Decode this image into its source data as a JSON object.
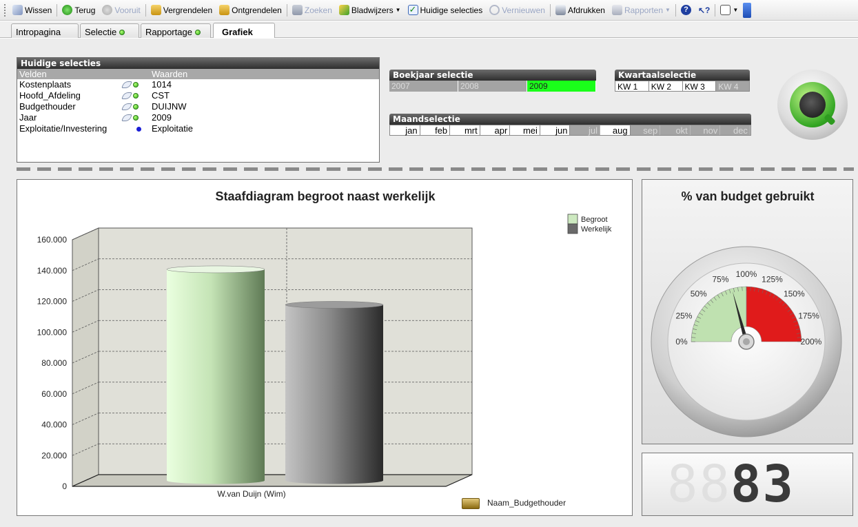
{
  "toolbar": {
    "items": [
      {
        "label": "Wissen",
        "enabled": true
      },
      {
        "label": "Terug",
        "enabled": true
      },
      {
        "label": "Vooruit",
        "enabled": false
      },
      {
        "label": "Vergrendelen",
        "enabled": true
      },
      {
        "label": "Ontgrendelen",
        "enabled": true
      },
      {
        "label": "Zoeken",
        "enabled": false
      },
      {
        "label": "Bladwijzers",
        "enabled": true
      },
      {
        "label": "Huidige selecties",
        "enabled": true
      },
      {
        "label": "Vernieuwen",
        "enabled": false
      },
      {
        "label": "Afdrukken",
        "enabled": true
      },
      {
        "label": "Rapporten",
        "enabled": false
      }
    ]
  },
  "tabs": [
    {
      "label": "Intropagina",
      "indicator": false
    },
    {
      "label": "Selectie",
      "indicator": true
    },
    {
      "label": "Rapportage",
      "indicator": true
    },
    {
      "label": "Grafiek",
      "indicator": false,
      "active": true
    }
  ],
  "current_selections": {
    "title": "Huidige selecties",
    "col_fields": "Velden",
    "col_values": "Waarden",
    "rows": [
      {
        "field": "Kostenplaats",
        "value": "1014"
      },
      {
        "field": "Hoofd_Afdeling",
        "value": "CST"
      },
      {
        "field": "Budgethouder",
        "value": "DUIJNW"
      },
      {
        "field": "Jaar",
        "value": "2009"
      },
      {
        "field": "Exploitatie/Investering",
        "value": "Exploitatie"
      }
    ]
  },
  "fiscal_year": {
    "title": "Boekjaar selectie",
    "values": [
      "2007",
      "2008",
      "2009"
    ],
    "selected": "2009"
  },
  "quarter": {
    "title": "Kwartaalselectie",
    "values": [
      "KW 1",
      "KW 2",
      "KW 3",
      "KW 4"
    ]
  },
  "month": {
    "title": "Maandselectie",
    "values": [
      "jan",
      "feb",
      "mrt",
      "apr",
      "mei",
      "jun",
      "jul",
      "aug",
      "sep",
      "okt",
      "nov",
      "dec"
    ]
  },
  "bar_chart": {
    "title": "Staafdiagram begroot naast werkelijk",
    "dimension_label": "Naam_Budgethouder"
  },
  "gauge": {
    "title": "% van budget gebruikt",
    "labels": [
      "0%",
      "25%",
      "50%",
      "75%",
      "100%",
      "125%",
      "150%",
      "175%",
      "200%"
    ]
  },
  "led": {
    "value": "83"
  },
  "colors": {
    "selected": "#1aff1a",
    "begroot": "#cde9c0",
    "werkelijk": "#6a6a6a",
    "gauge_green": "#bfe1b0",
    "gauge_red": "#e01b1b"
  },
  "chart_data": [
    {
      "type": "bar",
      "title": "Staafdiagram begroot naast werkelijk",
      "categories": [
        "W.van Duijn (Wim)"
      ],
      "series": [
        {
          "name": "Begroot",
          "values": [
            137000
          ]
        },
        {
          "name": "Werkelijk",
          "values": [
            114000
          ]
        }
      ],
      "xlabel": "",
      "ylabel": "",
      "ylim": [
        0,
        160000
      ],
      "yticks": [
        "0",
        "20.000",
        "40.000",
        "60.000",
        "80.000",
        "100.000",
        "120.000",
        "140.000",
        "160.000"
      ],
      "grid": true,
      "legend": "top-right"
    },
    {
      "type": "gauge",
      "title": "% van budget gebruikt",
      "value": 83,
      "range": [
        0,
        200
      ],
      "ticks": [
        "0%",
        "25%",
        "50%",
        "75%",
        "100%",
        "125%",
        "150%",
        "175%",
        "200%"
      ],
      "segments": [
        {
          "from": 0,
          "to": 100,
          "color": "#bfe1b0"
        },
        {
          "from": 100,
          "to": 200,
          "color": "#e01b1b"
        }
      ]
    }
  ]
}
